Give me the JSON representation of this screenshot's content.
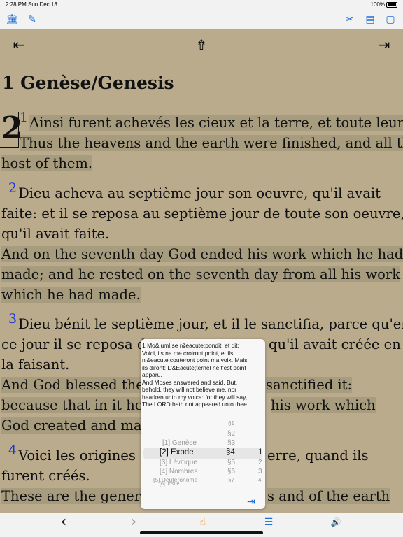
{
  "status": {
    "time": "2:28 PM",
    "date": "Sun Dec 13",
    "battery": "100%"
  },
  "toolbar": {
    "left": [
      {
        "name": "library-icon",
        "glyph": "🏛"
      },
      {
        "name": "edit-icon",
        "glyph": "✎"
      }
    ],
    "right": [
      {
        "name": "tools-icon",
        "glyph": "✂"
      },
      {
        "name": "book-info-icon",
        "glyph": "▤"
      },
      {
        "name": "page-icon",
        "glyph": "▢"
      }
    ]
  },
  "nav": {
    "first_glyph": "⇤",
    "up_glyph": "⇮",
    "last_glyph": "⇥"
  },
  "chapter": {
    "title": "1 Genèse/Genesis",
    "number": "2"
  },
  "lines": [
    {
      "text": "Ainsi furent achevés les cieux et la terre, et toute leur a",
      "vnum": "1"
    },
    {
      "text": "Thus the heavens and the earth were finished, and all the"
    },
    {
      "text": "host of them."
    },
    {
      "text": "Dieu acheva au septième jour son oeuvre, qu'il avait",
      "vnum": "2"
    },
    {
      "text": "faite: et il se reposa au septième jour de toute son oeuvre,"
    },
    {
      "text": "qu'il avait faite."
    },
    {
      "text": "And on the seventh day God ended his work which he had"
    },
    {
      "text": "made; and he rested on the seventh day from all his work"
    },
    {
      "text": "which he had made."
    },
    {
      "text": "Dieu bénit le septième jour, et il le sanctifia, parce qu'en",
      "vnum": "3"
    },
    {
      "text": "ce jour il se reposa d"
    },
    {
      "text": "qu'il avait créée en"
    },
    {
      "text": "la faisant."
    },
    {
      "text": "And God blessed the"
    },
    {
      "text": "sanctified it:"
    },
    {
      "text": "because that in it he"
    },
    {
      "text": "his work which"
    },
    {
      "text": "God created and mad"
    },
    {
      "text": "Voici les origines",
      "vnum": "4"
    },
    {
      "text": "erre, quand ils"
    },
    {
      "text": "furent créés."
    },
    {
      "text": "These are the genera"
    },
    {
      "text": "s and of the earth"
    }
  ],
  "popup": {
    "text_lines": [
      "1 Mo&iuml;se r&eacute;pondit, et dit:",
      "Voici, ils ne me croiront point, et ils",
      "n'&eacute;couteront point ma voix. Mais",
      "ils diront: L'&Eacute;ternel ne t'est point",
      "apparu.",
      "And Moses answered and said, But,",
      "behold, they will not believe me, nor",
      "hearken unto my voice: for they will say,",
      "The LORD hath not appeared unto thee."
    ],
    "books": [
      "[1] Genèse",
      "[2] Exode",
      "[3] Lévitique",
      "[4] Nombres",
      "[5] Deutéronome",
      "[6] Josué"
    ],
    "sections": [
      "§1",
      "§2",
      "§3",
      "§4",
      "§5",
      "§6",
      "§7"
    ],
    "verses": [
      "1",
      "2",
      "3",
      "4"
    ],
    "selected_book": "[2] Exode",
    "selected_section": "§4",
    "selected_verse": "1",
    "go_glyph": "⇥"
  },
  "bottom": {
    "back_glyph": "‹",
    "forward_glyph": "›",
    "touch_glyph": "☝",
    "list_glyph": "☰",
    "audio_glyph": "🔊"
  },
  "colors": {
    "accent": "#1e6fd9",
    "verse_number": "#1a33d6",
    "page": "#b9ab8c",
    "highlight": "#a89c7f"
  }
}
